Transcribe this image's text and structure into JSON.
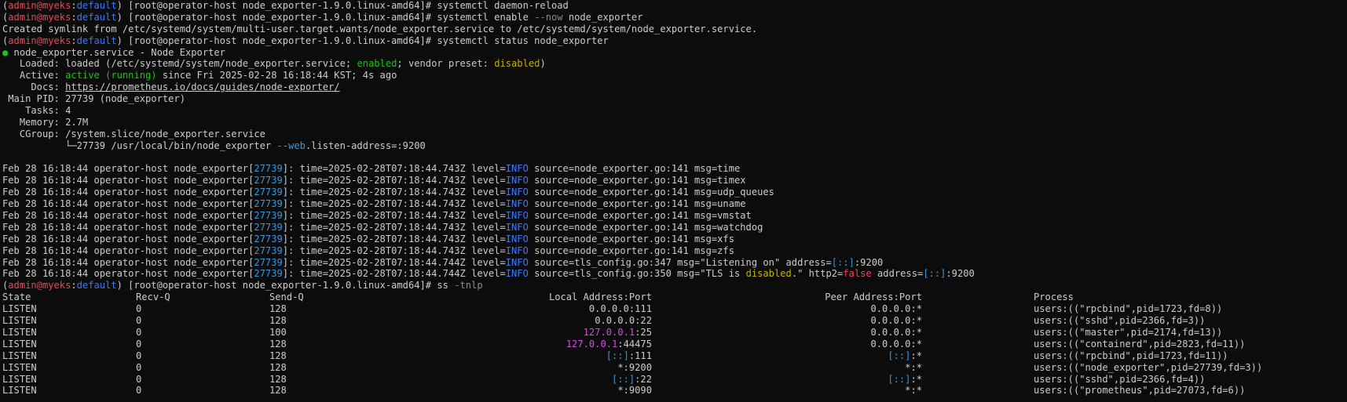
{
  "colors": {
    "background": "#0c0c0c",
    "text": "#cccccc",
    "prompt_user": "#e74856",
    "prompt_context": "#3b78ff",
    "status_ok": "#16c60c",
    "vendor_preset": "#c5b000",
    "log_pid": "#3a96dd",
    "loopback_ip": "#d54ae0"
  },
  "prompt": {
    "open": "(",
    "user": "admin@myeks",
    "sep": ":",
    "context": "default",
    "close": ")",
    "host": " [root@operator-host node_exporter-1.9.0.linux-amd64]# "
  },
  "commands": {
    "daemon_reload": "systemctl daemon-reload",
    "enable_pre": "systemctl enable ",
    "enable_flag": "--now",
    "enable_post": " node_exporter",
    "status": "systemctl status node_exporter",
    "ss_pre": "ss ",
    "ss_flag": "-tnlp"
  },
  "symlink_output": "Created symlink from /etc/systemd/system/multi-user.target.wants/node_exporter.service to /etc/systemd/system/node_exporter.service.",
  "status": {
    "bullet": "●",
    "title": " node_exporter.service - Node Exporter",
    "loaded_label": "   Loaded: ",
    "loaded_pre": "loaded (/etc/systemd/system/node_exporter.service; ",
    "loaded_enabled": "enabled",
    "loaded_mid": "; vendor preset: ",
    "loaded_preset": "disabled",
    "loaded_post": ")",
    "active_label": "   Active: ",
    "active_state": "active (running)",
    "active_post": " since Fri 2025-02-28 16:18:44 KST; 4s ago",
    "docs_label": "     Docs: ",
    "docs_url": "https://prometheus.io/docs/guides/node-exporter/",
    "mainpid": " Main PID: 27739 (node_exporter)",
    "tasks": "    Tasks: 4",
    "memory": "   Memory: 2.7M",
    "cgroup": "   CGroup: /system.slice/node_exporter.service",
    "cgroup_child_pre": "           └─27739 /usr/local/bin/node_exporter ",
    "cgroup_child_flag_a": "--",
    "cgroup_child_flag_b": "web",
    "cgroup_child_flag_c": ".listen-address=:9200"
  },
  "log": {
    "prefix": "Feb 28 16:18:44 operator-host node_exporter[",
    "pid": "27739",
    "prefix_end": "]: ",
    "level_label": "level=",
    "level": "INFO",
    "entries": [
      {
        "time": "time=2025-02-28T07:18:44.743Z ",
        "rest": " source=node_exporter.go:141 msg=time"
      },
      {
        "time": "time=2025-02-28T07:18:44.743Z ",
        "rest": " source=node_exporter.go:141 msg=timex"
      },
      {
        "time": "time=2025-02-28T07:18:44.743Z ",
        "rest": " source=node_exporter.go:141 msg=udp_queues"
      },
      {
        "time": "time=2025-02-28T07:18:44.743Z ",
        "rest": " source=node_exporter.go:141 msg=uname"
      },
      {
        "time": "time=2025-02-28T07:18:44.743Z ",
        "rest": " source=node_exporter.go:141 msg=vmstat"
      },
      {
        "time": "time=2025-02-28T07:18:44.743Z ",
        "rest": " source=node_exporter.go:141 msg=watchdog"
      },
      {
        "time": "time=2025-02-28T07:18:44.743Z ",
        "rest": " source=node_exporter.go:141 msg=xfs"
      },
      {
        "time": "time=2025-02-28T07:18:44.743Z ",
        "rest": " source=node_exporter.go:141 msg=zfs"
      }
    ],
    "listening": {
      "time": "time=2025-02-28T07:18:44.744Z ",
      "rest_pre": " source=tls_config.go:347 msg=\"Listening on\" address=",
      "addr": "[::]",
      "rest_post": ":9200"
    },
    "tls": {
      "time": "time=2025-02-28T07:18:44.744Z ",
      "rest_pre": " source=tls_config.go:350 msg=\"TLS is ",
      "disabled": "disabled",
      "rest_mid": ".\" http2=",
      "false": "false",
      "rest_addr": " address=",
      "addr": "[::]",
      "rest_post": ":9200"
    }
  },
  "ss": {
    "headers": {
      "state": "State",
      "recv": "Recv-Q",
      "send": "Send-Q",
      "local": "Local Address:Port",
      "peer": "Peer Address:Port",
      "process": "Process"
    },
    "rows": [
      {
        "state": "LISTEN",
        "recv": "0",
        "send": "128",
        "local_ip": "0.0.0.0",
        "local_port": ":111",
        "peer_ip": "0.0.0.0",
        "peer_port": ":*",
        "process": "users:((\"rpcbind\",pid=1723,fd=8))"
      },
      {
        "state": "LISTEN",
        "recv": "0",
        "send": "128",
        "local_ip": "0.0.0.0",
        "local_port": ":22",
        "peer_ip": "0.0.0.0",
        "peer_port": ":*",
        "process": "users:((\"sshd\",pid=2366,fd=3))"
      },
      {
        "state": "LISTEN",
        "recv": "0",
        "send": "100",
        "local_ip": "127.0.0.1",
        "local_port": ":25",
        "peer_ip": "0.0.0.0",
        "peer_port": ":*",
        "process": "users:((\"master\",pid=2174,fd=13))"
      },
      {
        "state": "LISTEN",
        "recv": "0",
        "send": "128",
        "local_ip": "127.0.0.1",
        "local_port": ":44475",
        "peer_ip": "0.0.0.0",
        "peer_port": ":*",
        "process": "users:((\"containerd\",pid=2823,fd=11))"
      },
      {
        "state": "LISTEN",
        "recv": "0",
        "send": "128",
        "local_ip": "[::]",
        "local_port": ":111",
        "peer_ip": "[::]",
        "peer_port": ":*",
        "process": "users:((\"rpcbind\",pid=1723,fd=11))"
      },
      {
        "state": "LISTEN",
        "recv": "0",
        "send": "128",
        "local_ip": "*",
        "local_port": ":9200",
        "peer_ip": "*",
        "peer_port": ":*",
        "process": "users:((\"node_exporter\",pid=27739,fd=3))"
      },
      {
        "state": "LISTEN",
        "recv": "0",
        "send": "128",
        "local_ip": "[::]",
        "local_port": ":22",
        "peer_ip": "[::]",
        "peer_port": ":*",
        "process": "users:((\"sshd\",pid=2366,fd=4))"
      },
      {
        "state": "LISTEN",
        "recv": "0",
        "send": "128",
        "local_ip": "*",
        "local_port": ":9090",
        "peer_ip": "*",
        "peer_port": ":*",
        "process": "users:((\"prometheus\",pid=27073,fd=6))"
      }
    ]
  }
}
